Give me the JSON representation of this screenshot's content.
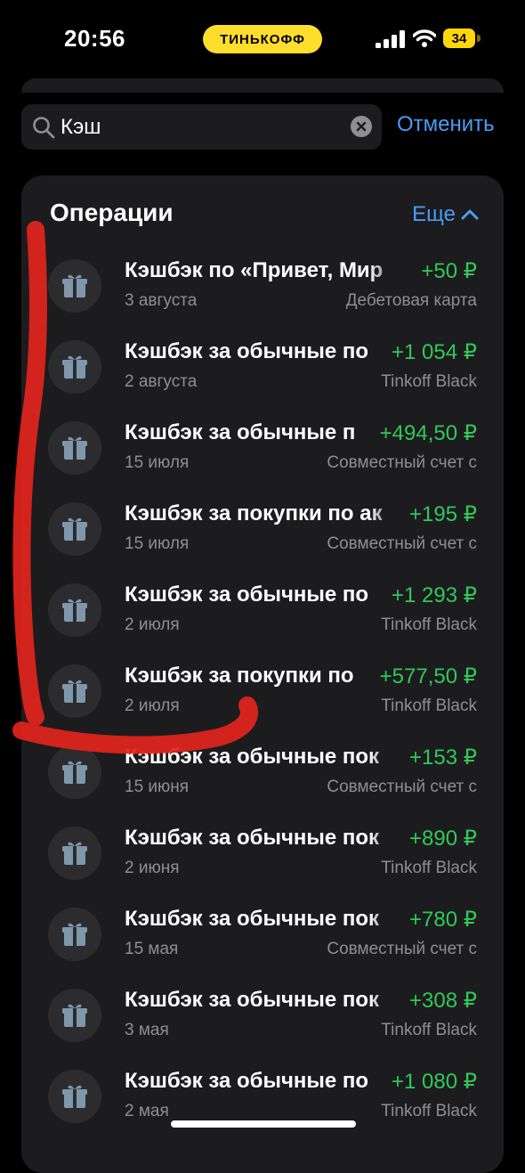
{
  "status_bar": {
    "time": "20:56",
    "brand_pill": "ТИНЬКОФФ",
    "battery": "34"
  },
  "search": {
    "value": "Кэш",
    "placeholder": "",
    "cancel_label": "Отменить"
  },
  "operations": {
    "title": "Операции",
    "more_label": "Еще",
    "items": [
      {
        "title": "Кэшбэк по «Привет, Мир",
        "amount": "+50 ₽",
        "date": "3 августа",
        "account": "Дебетовая карта"
      },
      {
        "title": "Кэшбэк за обычные по",
        "amount": "+1 054 ₽",
        "date": "2 августа",
        "account": "Tinkoff Black"
      },
      {
        "title": "Кэшбэк за обычные п",
        "amount": "+494,50 ₽",
        "date": "15 июля",
        "account": "Совместный счет с"
      },
      {
        "title": "Кэшбэк за покупки по ак",
        "amount": "+195 ₽",
        "date": "15 июля",
        "account": "Совместный счет с"
      },
      {
        "title": "Кэшбэк за обычные по",
        "amount": "+1 293 ₽",
        "date": "2 июля",
        "account": "Tinkoff Black"
      },
      {
        "title": "Кэшбэк за покупки по",
        "amount": "+577,50 ₽",
        "date": "2 июля",
        "account": "Tinkoff Black"
      },
      {
        "title": "Кэшбэк за обычные пок",
        "amount": "+153 ₽",
        "date": "15 июня",
        "account": "Совместный счет с"
      },
      {
        "title": "Кэшбэк за обычные пок",
        "amount": "+890 ₽",
        "date": "2 июня",
        "account": "Tinkoff Black"
      },
      {
        "title": "Кэшбэк за обычные пок",
        "amount": "+780 ₽",
        "date": "15 мая",
        "account": "Совместный счет с"
      },
      {
        "title": "Кэшбэк за обычные пок",
        "amount": "+308 ₽",
        "date": "3 мая",
        "account": "Tinkoff Black"
      },
      {
        "title": "Кэшбэк за обычные по",
        "amount": "+1 080 ₽",
        "date": "2 мая",
        "account": "Tinkoff Black"
      }
    ]
  },
  "colors": {
    "accent_blue": "#4a9cf5",
    "income_green": "#30c958",
    "brand_yellow": "#ffdd2d",
    "annotation_red": "#e0231c"
  },
  "icons": [
    "search-icon",
    "clear-icon",
    "chevron-up-icon",
    "gift-icon"
  ]
}
